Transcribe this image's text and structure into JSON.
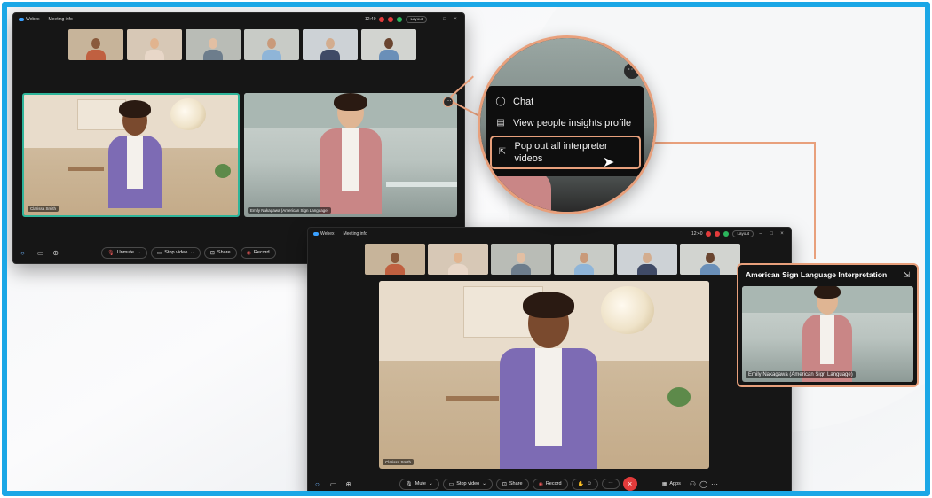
{
  "window_small": {
    "app_name": "Webex",
    "tab": "Meeting info",
    "time": "12:40",
    "layout_label": "Layout",
    "tile_names": [
      "Clarissa Smith",
      "Emily Nakagawa (American Sign Language)"
    ],
    "toolbar": {
      "unmute": "Unmute",
      "stop_video": "Stop video",
      "share": "Share",
      "record": "Record"
    }
  },
  "window_large": {
    "app_name": "Webex",
    "tab": "Meeting info",
    "time": "12:40",
    "layout_label": "Layout",
    "tile_name": "Clarissa Smith",
    "toolbar": {
      "mute": "Mute",
      "stop_video": "Stop video",
      "share": "Share",
      "record": "Record",
      "apps": "Apps"
    }
  },
  "context_menu": {
    "items": [
      {
        "label": "Chat",
        "icon": "chat-icon"
      },
      {
        "label": "View people insights profile",
        "icon": "profile-card-icon"
      },
      {
        "label": "Pop out all interpreter videos",
        "icon": "pop-out-icon"
      }
    ]
  },
  "interpreter_panel": {
    "title": "American Sign Language Interpretation",
    "name": "Emily Nakagawa (American Sign Language)"
  },
  "colors": {
    "accent": "#e8a07c",
    "frame": "#1ba7e6",
    "leave": "#e23b3b"
  }
}
